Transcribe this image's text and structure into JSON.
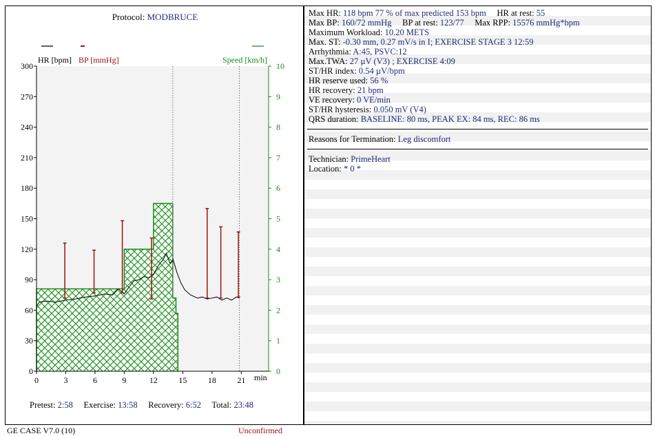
{
  "header": {
    "protocol_label": "Protocol:",
    "protocol_value": "MODBRUCE"
  },
  "legend": {
    "hr": "HR [bpm]",
    "bp": "BP  [mmHg]",
    "speed": "Speed [km/h]"
  },
  "colors": {
    "hr": "#000000",
    "bp": "#a01010",
    "speed": "#1a8a1a",
    "values": "#1c2a78"
  },
  "chart_data": {
    "type": "line",
    "xlabel": "min",
    "ylabel_left": "HR [bpm]",
    "ylabel_right": "Speed [km/h]",
    "xlim": [
      0,
      23.8
    ],
    "ylim_left": [
      0,
      300
    ],
    "ylim_right": [
      0,
      10
    ],
    "x_ticks": [
      0,
      3,
      6,
      9,
      12,
      15,
      18,
      21
    ],
    "y_ticks_left": [
      0,
      30,
      60,
      90,
      120,
      150,
      180,
      210,
      240,
      270,
      300
    ],
    "y_ticks_right": [
      0,
      1,
      2,
      3,
      4,
      5,
      6,
      7,
      8,
      9,
      10
    ],
    "vertical_markers": [
      13.97,
      20.8
    ],
    "speed_steps": [
      {
        "t0": 0,
        "t1": 5.8,
        "speed": 2.7
      },
      {
        "t0": 5.8,
        "t1": 9.0,
        "speed": 2.7
      },
      {
        "t0": 9.0,
        "t1": 12.0,
        "speed": 4.0
      },
      {
        "t0": 12.0,
        "t1": 13.97,
        "speed": 5.5
      },
      {
        "t0": 13.97,
        "t1": 14.3,
        "speed": 2.4
      },
      {
        "t0": 14.3,
        "t1": 14.5,
        "speed": 1.9
      }
    ],
    "hr_series": {
      "name": "HR [bpm]",
      "x": [
        0,
        0.3,
        1,
        2,
        3,
        4,
        5,
        6,
        7,
        7.8,
        8.4,
        9,
        9.5,
        10,
        10.5,
        11,
        11.5,
        12,
        12.5,
        13,
        13.3,
        13.7,
        14,
        14.4,
        14.8,
        15.2,
        15.8,
        16.5,
        17,
        17.5,
        18,
        18.5,
        19,
        19.5,
        20,
        20.5,
        20.8
      ],
      "y": [
        64,
        68,
        69,
        68,
        70,
        71,
        73,
        74,
        76,
        75,
        81,
        76,
        83,
        89,
        90,
        93,
        92,
        95,
        104,
        110,
        116,
        106,
        110,
        97,
        87,
        80,
        75,
        72,
        73,
        71,
        72,
        73,
        70,
        72,
        70,
        73,
        72
      ]
    },
    "bp_series": {
      "name": "BP  [mmHg]",
      "points": [
        {
          "t": 2.9,
          "sys": 126,
          "dia": 72
        },
        {
          "t": 5.9,
          "sys": 119,
          "dia": 77
        },
        {
          "t": 8.8,
          "sys": 148,
          "dia": 77
        },
        {
          "t": 11.8,
          "sys": 131,
          "dia": 71
        },
        {
          "t": 17.5,
          "sys": 160,
          "dia": 72
        },
        {
          "t": 18.9,
          "sys": 142,
          "dia": 72
        },
        {
          "t": 20.7,
          "sys": 137,
          "dia": 73
        }
      ]
    }
  },
  "durations": {
    "pretest_label": "Pretest:",
    "pretest": "2:58",
    "exercise_label": "Exercise:",
    "exercise": "13:58",
    "recovery_label": "Recovery:",
    "recovery": "6:52",
    "total_label": "Total:",
    "total": "23:48"
  },
  "stats": {
    "max_hr_label": "Max HR:",
    "max_hr": "118 bpm   77 % of max predicted 153 bpm",
    "hr_rest_label": "HR at rest:",
    "hr_rest": "55",
    "max_bp_label": "Max BP:",
    "max_bp": "160/72 mmHg",
    "bp_rest_label": "BP at rest:",
    "bp_rest": "123/77",
    "max_rpp_label": "Max RPP:",
    "max_rpp": "15576 mmHg*bpm",
    "workload_label": "Maximum Workload:",
    "workload": "10.20 METS",
    "max_st_label": "Max. ST:",
    "max_st": "-0.30 mm,  0.27 mV/s  in I; EXERCISE  STAGE 3  12:59",
    "arrhythmia_label": "Arrhythmia:",
    "arrhythmia": "A:45,   PSVC:12",
    "max_twa_label": "Max.TWA:",
    "max_twa": "27 µV (V3) ; EXERCISE  4:09",
    "st_hr_index_label": "ST/HR index:",
    "st_hr_index": "0.54 µV/bpm",
    "hr_reserve_label": "HR reserve used:",
    "hr_reserve": "56 %",
    "hr_recovery_label": "HR recovery:",
    "hr_recovery": "21 bpm",
    "ve_recovery_label": "VE recovery:",
    "ve_recovery": "0 VE/min",
    "st_hr_hyst_label": "ST/HR hysteresis:",
    "st_hr_hyst": "0.050 mV (V4)",
    "qrs_label": "QRS duration:",
    "qrs": "BASELINE:  80 ms, PEAK EX:  84 ms, REC:  86 ms"
  },
  "termination": {
    "label": "Reasons for Termination:",
    "value": "Leg discomfort"
  },
  "technician": {
    "label": "Technician:",
    "value": "PrimeHeart",
    "location_label": "Location:",
    "location_value": "* 0 *"
  },
  "footer": {
    "version": "GE CASE V7.0 (10)",
    "status": "Unconfirmed"
  }
}
